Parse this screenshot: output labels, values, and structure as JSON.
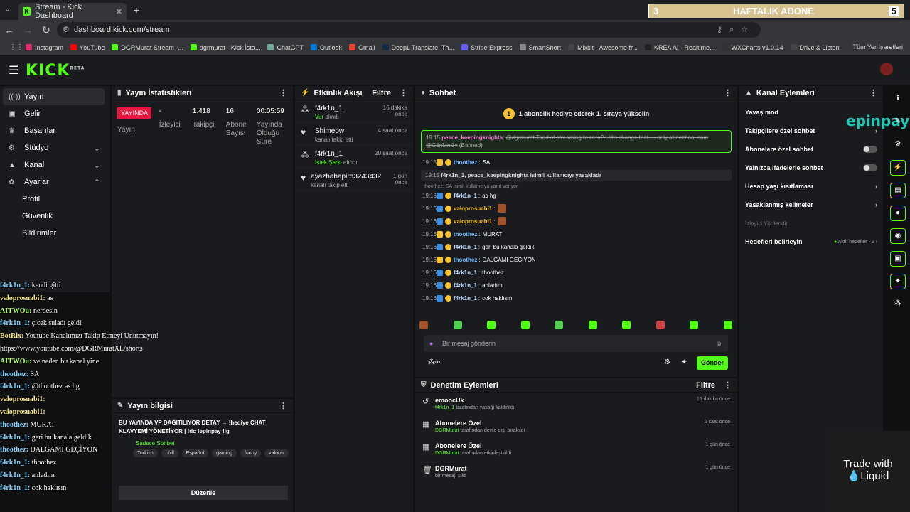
{
  "browser": {
    "tab_title": "Stream - Kick Dashboard",
    "url": "dashboard.kick.com/stream",
    "bookmarks": [
      "Instagram",
      "YouTube",
      "DGRMurat Stream -...",
      "dgrmurat - Kick İsta...",
      "ChatGPT",
      "Outlook",
      "Gmail",
      "DeepL Translate: Th...",
      "Stripe Express",
      "SmartShort",
      "Mixkit - Awesome fr...",
      "KREA AI - Realtime...",
      "WXCharts v1.0.14",
      "Drive & Listen"
    ],
    "all_bookmarks": "Tüm Yer İşaretleri"
  },
  "overlay": {
    "left": "3",
    "title": "HAFTALIK ABONE",
    "right": "5"
  },
  "sidebar": {
    "items": [
      {
        "label": "Yayın"
      },
      {
        "label": "Gelir"
      },
      {
        "label": "Başarılar"
      },
      {
        "label": "Stüdyo"
      },
      {
        "label": "Kanal"
      },
      {
        "label": "Ayarlar"
      }
    ],
    "subs": [
      "Profil",
      "Güvenlik",
      "Bildirimler"
    ]
  },
  "stats": {
    "title": "Yayın İstatistikleri",
    "live": "YAYINDA",
    "status": "Yayın",
    "viewers_value": "-",
    "viewers_label": "İzleyici",
    "followers_value": "1.418",
    "followers_label": "Takipçi",
    "subs_value": "16",
    "subs_label": "Abone Sayısı",
    "uptime_value": "00:05:59",
    "uptime_label": "Yayında Olduğu Süre"
  },
  "events": {
    "title": "Etkinlik Akışı",
    "filter": "Filtre",
    "items": [
      {
        "name": "f4rk1n_1",
        "action_hl": "Vur",
        "action": "alındı",
        "time": "16 dakika önce"
      },
      {
        "name": "Shimeow",
        "action_hl": "",
        "action": "kanalı takip etti",
        "time": "4 saat önce"
      },
      {
        "name": "f4rk1n_1",
        "action_hl": "İstek Şarkı",
        "action": "alındı",
        "time": "20 saat önce"
      },
      {
        "name": "ayazbabapiro3243432",
        "action_hl": "",
        "action": "kanalı takip etti",
        "time": "1 gün önce"
      }
    ]
  },
  "chat": {
    "title": "Sohbet",
    "pinned": "1 abonelik hediye ederek 1. sıraya yükselin",
    "pinned_badge": "1",
    "banned_time": "19:15",
    "banned_user": "peace_keepingknighta",
    "banned_text": "@dgrmurat Tired of streaming to zero? Let's change that — only at nezhna .com @G6nMnl3v",
    "banned_tag": "(Banned)",
    "system": "f4rk1n_1, peace_keepingknighta isimli kullanıcıyı yasakladı",
    "reply": "thoothez: SA isimli kullanıcıya yanıt veriyor",
    "messages": [
      {
        "time": "19:15",
        "user": "thoothez",
        "text": "SA",
        "color": "#6fb8ff"
      },
      {
        "time": "19:16",
        "user": "f4rk1n_1",
        "text": "as hg",
        "color": "#b8d7ff"
      },
      {
        "time": "19:16",
        "user": "valoprosuabi1",
        "text": "",
        "color": "#f7c332"
      },
      {
        "time": "19:16",
        "user": "valoprosuabi1",
        "text": "",
        "color": "#f7c332"
      },
      {
        "time": "19:16",
        "user": "thoothez",
        "text": "MURAT",
        "color": "#6fb8ff"
      },
      {
        "time": "19:16",
        "user": "f4rk1n_1",
        "text": "geri bu kanala geldik",
        "color": "#b8d7ff"
      },
      {
        "time": "19:16",
        "user": "thoothez",
        "text": "DALGAMI GEÇİYON",
        "color": "#6fb8ff"
      },
      {
        "time": "19:16",
        "user": "f4rk1n_1",
        "text": "thoothez",
        "color": "#b8d7ff"
      },
      {
        "time": "19:16",
        "user": "f4rk1n_1",
        "text": "anladım",
        "color": "#b8d7ff"
      },
      {
        "time": "19:16",
        "user": "f4rk1n_1",
        "text": "cok haklısın",
        "color": "#b8d7ff"
      }
    ],
    "placeholder": "Bir mesaj gönderin",
    "send": "Gönder"
  },
  "modlog": {
    "title": "Denetim Eylemleri",
    "filter": "Filtre",
    "items": [
      {
        "name": "emoocUk",
        "by": "f4rk1n_1",
        "action": "tarafından yasağı kaldırıldı",
        "time": "16 dakika önce"
      },
      {
        "name": "Abonelere Özel",
        "by": "DGRMurat",
        "action": "tarafından devre dışı bırakıldı",
        "time": "2 saat önce"
      },
      {
        "name": "Abonelere Özel",
        "by": "DGRMurat",
        "action": "tarafından etkinleştirildi",
        "time": "1 gün önce"
      },
      {
        "name": "DGRMurat",
        "by": "",
        "action": "bir mesajı sildi",
        "time": "1 gün önce"
      }
    ]
  },
  "channel": {
    "title": "Kanal Eylemleri",
    "items": [
      "Yavaş mod",
      "Takipçilere özel sohbet",
      "Abonelere özel sohbet",
      "Yalnızca ifadelerle sohbet",
      "Hesap yaşı kısıtlaması",
      "Yasaklanmış kelimeler"
    ],
    "dim": "İzleyici Yönlendir",
    "goals": "Hedefleri belirleyin",
    "goals_status": "Aktif hedefler - 2"
  },
  "info": {
    "title": "Yayın bilgisi",
    "text": "BU YAYINDA VP DAĞITILIYOR DETAY → !hediye CHAT KLAVYEMİ YÖNETİYOR | !dc !epinpay !ig",
    "category": "Sadece Sohbet",
    "tags": [
      "Turkish",
      "chill",
      "Español",
      "gaming",
      "funny",
      "valorar"
    ],
    "edit": "Düzenle"
  },
  "obs_chat": [
    {
      "u": "f4rk1n_1:",
      "t": "kendi gitti",
      "c": "a"
    },
    {
      "u": "valoprosuabi1:",
      "t": "as",
      "c": "b"
    },
    {
      "u": "AITWOu:",
      "t": "nerdesin",
      "c": "g"
    },
    {
      "u": "f4rk1n_1:",
      "t": "çicek suladı geldi",
      "c": "a"
    },
    {
      "u": "BotRix:",
      "t": "Youtube Kanalımızı Takip Etmeyi Unutmayın!",
      "c": "b"
    },
    {
      "u": "",
      "t": "https://www.youtube.com/@DGRMuratXL/shorts",
      "c": "c"
    },
    {
      "u": "AITWOu:",
      "t": "ve neden bu kanal yine",
      "c": "g"
    },
    {
      "u": "thoothez:",
      "t": "SA",
      "c": "a"
    },
    {
      "u": "f4rk1n_1:",
      "t": "@thoothez as hg",
      "c": "a"
    },
    {
      "u": "valoprosuabi1:",
      "t": "",
      "c": "b"
    },
    {
      "u": "valoprosuabi1:",
      "t": "",
      "c": "b"
    },
    {
      "u": "thoothez:",
      "t": "MURAT",
      "c": "a"
    },
    {
      "u": "f4rk1n_1:",
      "t": "geri bu kanala geldik",
      "c": "a"
    },
    {
      "u": "thoothez:",
      "t": "DALGAMI GEÇİYON",
      "c": "a"
    },
    {
      "u": "f4rk1n_1:",
      "t": "thoothez",
      "c": "a"
    },
    {
      "u": "f4rk1n_1:",
      "t": "anladım",
      "c": "a"
    },
    {
      "u": "f4rk1n_1:",
      "t": "cok haklısın",
      "c": "a"
    }
  ],
  "promo": {
    "trade_line1": "Trade with",
    "trade_line2": "Liquid",
    "epinpay": "epinpay"
  }
}
